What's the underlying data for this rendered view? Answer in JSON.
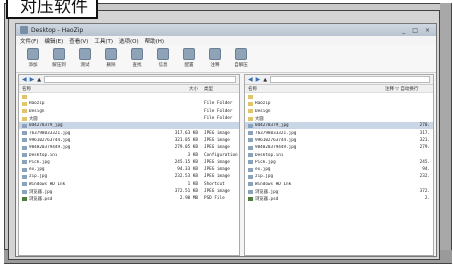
{
  "caption": "对压软件",
  "window": {
    "title": "Desktop - HaoZip",
    "controls": [
      "_",
      "□",
      "×"
    ]
  },
  "menu": [
    "文件(F)",
    "编辑(E)",
    "查看(V)",
    "工具(T)",
    "选项(O)",
    "帮助(H)"
  ],
  "toolbar": [
    "添加",
    "解压到",
    "测试",
    "删除",
    "查找",
    "信息",
    "配置",
    "注释",
    "自解压"
  ],
  "left_pane": {
    "columns": {
      "name": "名称",
      "size": "大小",
      "type": "类型"
    },
    "rows": [
      {
        "icon": "folder",
        "name": "",
        "size": "",
        "type": ""
      },
      {
        "icon": "folder",
        "name": "Haozip",
        "size": "",
        "type": "File Folder"
      },
      {
        "icon": "folder",
        "name": "Design",
        "size": "",
        "type": "File Folder"
      },
      {
        "icon": "folder",
        "name": "大圆",
        "size": "",
        "type": "File Folder"
      },
      {
        "icon": "file",
        "name": "0d4278379_jpg",
        "size": "",
        "type": "",
        "selected": true
      },
      {
        "icon": "file",
        "name": "763798033321.jpg",
        "size": "317.63 KB",
        "type": "JPEG image"
      },
      {
        "icon": "file",
        "name": "996102763744.jpg",
        "size": "321.05 KB",
        "type": "JPEG image"
      },
      {
        "icon": "file",
        "name": "984820379449.jpg",
        "size": "279.05 KB",
        "type": "JPEG image"
      },
      {
        "icon": "file",
        "name": "Desktop.ini",
        "size": "3 KB",
        "type": "Configuration"
      },
      {
        "icon": "file",
        "name": "Pick.jpg",
        "size": "245.15 KB",
        "type": "JPEG image"
      },
      {
        "icon": "file",
        "name": "ex.jpg",
        "size": "94.33 KB",
        "type": "JPEG image"
      },
      {
        "icon": "file",
        "name": "zip.jpg",
        "size": "232.53 KB",
        "type": "JPEG image"
      },
      {
        "icon": "file",
        "name": "Windows HD Ink",
        "size": "1 KB",
        "type": "Shortcut"
      },
      {
        "icon": "file",
        "name": "浏览器.jpg",
        "size": "372.51 KB",
        "type": "JPEG image"
      },
      {
        "icon": "pack",
        "name": "浏览器.psd",
        "size": "2.90 MB",
        "type": "PSD File"
      }
    ]
  },
  "right_pane": {
    "columns": {
      "name": "名称",
      "extra": "注释 ▽ 自动换行"
    },
    "rows": [
      {
        "icon": "folder",
        "name": "",
        "size": ""
      },
      {
        "icon": "folder",
        "name": "Haozip",
        "size": ""
      },
      {
        "icon": "folder",
        "name": "Design",
        "size": ""
      },
      {
        "icon": "folder",
        "name": "大圆",
        "size": ""
      },
      {
        "icon": "file",
        "name": "0d4278379_jpg",
        "size": "270.",
        "selected": true
      },
      {
        "icon": "file",
        "name": "763798033321.jpg",
        "size": "317."
      },
      {
        "icon": "file",
        "name": "996102763744.jpg",
        "size": "321."
      },
      {
        "icon": "file",
        "name": "984820379449.jpg",
        "size": "279."
      },
      {
        "icon": "file",
        "name": "Desktop.ini",
        "size": ""
      },
      {
        "icon": "file",
        "name": "Pick.jpg",
        "size": "245."
      },
      {
        "icon": "file",
        "name": "ex.jpg",
        "size": "94."
      },
      {
        "icon": "file",
        "name": "zip.jpg",
        "size": "232."
      },
      {
        "icon": "file",
        "name": "Windows HD Ink",
        "size": ""
      },
      {
        "icon": "file",
        "name": "浏览器.jpg",
        "size": "372."
      },
      {
        "icon": "pack",
        "name": "浏览器.psd",
        "size": "2."
      }
    ]
  }
}
